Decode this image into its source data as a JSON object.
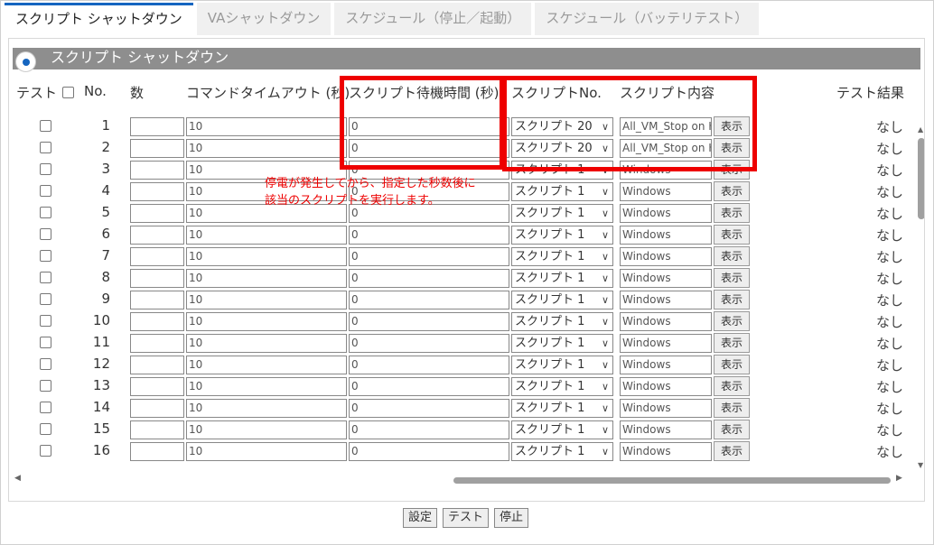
{
  "tabs": [
    {
      "label": "スクリプト シャットダウン",
      "active": true
    },
    {
      "label": "VAシャットダウン",
      "active": false
    },
    {
      "label": "スケジュール（停止／起動）",
      "active": false
    },
    {
      "label": "スケジュール（バッテリテスト）",
      "active": false
    }
  ],
  "section": {
    "title": "スクリプト シャットダウン"
  },
  "columns": {
    "test": "テスト",
    "no": "No.",
    "count": "数",
    "cmd_timeout": "コマンドタイムアウト (秒)",
    "wait_time": "スクリプト待機時間 (秒)",
    "script_no": "スクリプトNo.",
    "script_content": "スクリプト内容",
    "result": "テスト結果"
  },
  "show_label": "表示",
  "rows": [
    {
      "no": "1",
      "timeout": "10",
      "wait": "0",
      "script": "スクリプト 20",
      "content": "All_VM_Stop on H",
      "result": "なし"
    },
    {
      "no": "2",
      "timeout": "10",
      "wait": "0",
      "script": "スクリプト 20",
      "content": "All_VM_Stop on H",
      "result": "なし"
    },
    {
      "no": "3",
      "timeout": "10",
      "wait": "0",
      "script": "スクリプト 1",
      "content": "Windows",
      "result": "なし"
    },
    {
      "no": "4",
      "timeout": "10",
      "wait": "0",
      "script": "スクリプト 1",
      "content": "Windows",
      "result": "なし"
    },
    {
      "no": "5",
      "timeout": "10",
      "wait": "0",
      "script": "スクリプト 1",
      "content": "Windows",
      "result": "なし"
    },
    {
      "no": "6",
      "timeout": "10",
      "wait": "0",
      "script": "スクリプト 1",
      "content": "Windows",
      "result": "なし"
    },
    {
      "no": "7",
      "timeout": "10",
      "wait": "0",
      "script": "スクリプト 1",
      "content": "Windows",
      "result": "なし"
    },
    {
      "no": "8",
      "timeout": "10",
      "wait": "0",
      "script": "スクリプト 1",
      "content": "Windows",
      "result": "なし"
    },
    {
      "no": "9",
      "timeout": "10",
      "wait": "0",
      "script": "スクリプト 1",
      "content": "Windows",
      "result": "なし"
    },
    {
      "no": "10",
      "timeout": "10",
      "wait": "0",
      "script": "スクリプト 1",
      "content": "Windows",
      "result": "なし"
    },
    {
      "no": "11",
      "timeout": "10",
      "wait": "0",
      "script": "スクリプト 1",
      "content": "Windows",
      "result": "なし"
    },
    {
      "no": "12",
      "timeout": "10",
      "wait": "0",
      "script": "スクリプト 1",
      "content": "Windows",
      "result": "なし"
    },
    {
      "no": "13",
      "timeout": "10",
      "wait": "0",
      "script": "スクリプト 1",
      "content": "Windows",
      "result": "なし"
    },
    {
      "no": "14",
      "timeout": "10",
      "wait": "0",
      "script": "スクリプト 1",
      "content": "Windows",
      "result": "なし"
    },
    {
      "no": "15",
      "timeout": "10",
      "wait": "0",
      "script": "スクリプト 1",
      "content": "Windows",
      "result": "なし"
    },
    {
      "no": "16",
      "timeout": "10",
      "wait": "0",
      "script": "スクリプト 1",
      "content": "Windows",
      "result": "なし"
    }
  ],
  "annotation": {
    "text_line1": "停電が発生してから、指定した秒数後に",
    "text_line2": "該当のスクリプトを実行します。",
    "color": "#ee0000"
  },
  "footer": {
    "set": "設定",
    "test": "テスト",
    "stop": "停止"
  },
  "colors": {
    "accent": "#1565c0",
    "header_bg": "#8e8e8e"
  }
}
